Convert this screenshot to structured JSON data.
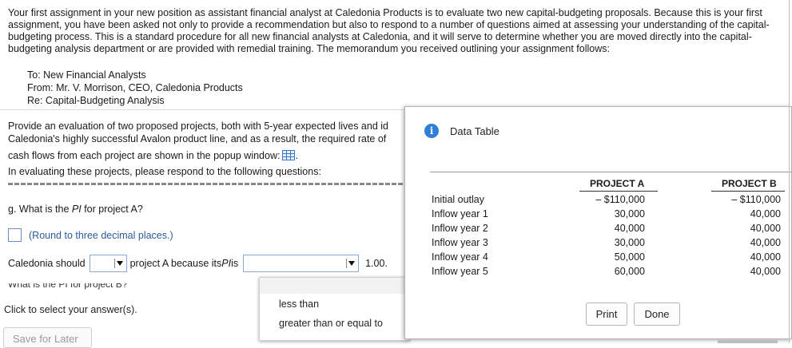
{
  "intro": "Your first assignment in your new position as assistant financial analyst at Caledonia Products is to evaluate two new capital-budgeting proposals. Because this is your first assignment, you have been asked not only to provide a recommendation but also to respond to a number of questions aimed at assessing your understanding of the capital-budgeting process. This is a standard procedure for all new financial analysts at Caledonia, and it will serve to determine whether you are moved directly into the capital-budgeting analysis department or are provided with remedial training. The memorandum you received outlining your assignment follows:",
  "memo": {
    "to": "To: New Financial Analysts",
    "from": "From: Mr. V. Morrison, CEO, Caledonia Products",
    "re": "Re: Capital-Budgeting Analysis"
  },
  "body": {
    "line1": "Provide an evaluation of two proposed projects, both with 5-year expected lives and id",
    "line2": "Caledonia's highly successful Avalon product line, and as a result, the required rate of",
    "line3": "cash flows from each project are shown in the popup window:",
    "line3_end": ".",
    "line4": "In evaluating these projects, please respond to the following questions:"
  },
  "question": {
    "prefix": "g. What is the ",
    "pi": "PI",
    "suffix": " for project A?",
    "hint": "(Round to three decimal places.)"
  },
  "sentence": {
    "part1": "Caledonia should",
    "part2": "project A because its ",
    "pi": "PI",
    "part3": " is",
    "part4": "1.00."
  },
  "cut_text": "What is the PI for project B?",
  "click_select": "Click to select your answer(s).",
  "save_button": "Save for Later",
  "dropdown": {
    "options": [
      "less than",
      "greater than or equal to"
    ]
  },
  "popup": {
    "title": "Data Table",
    "col_a": "PROJECT A",
    "col_b": "PROJECT B",
    "rows": [
      {
        "label": "Initial outlay",
        "a": "– $110,000",
        "b": "– $110,000"
      },
      {
        "label": "Inflow year 1",
        "a": "30,000",
        "b": "40,000"
      },
      {
        "label": "Inflow year 2",
        "a": "40,000",
        "b": "40,000"
      },
      {
        "label": "Inflow year 3",
        "a": "30,000",
        "b": "40,000"
      },
      {
        "label": "Inflow year 4",
        "a": "50,000",
        "b": "40,000"
      },
      {
        "label": "Inflow year 5",
        "a": "60,000",
        "b": "40,000"
      }
    ],
    "print_label": "Print",
    "done_label": "Done"
  },
  "icons": {
    "data_table": "grid-table-icon",
    "info": "info-icon",
    "dropdown": "chevron-down-icon"
  },
  "colors": {
    "accent": "#2f7fd6",
    "hint": "#2c5aa0"
  }
}
